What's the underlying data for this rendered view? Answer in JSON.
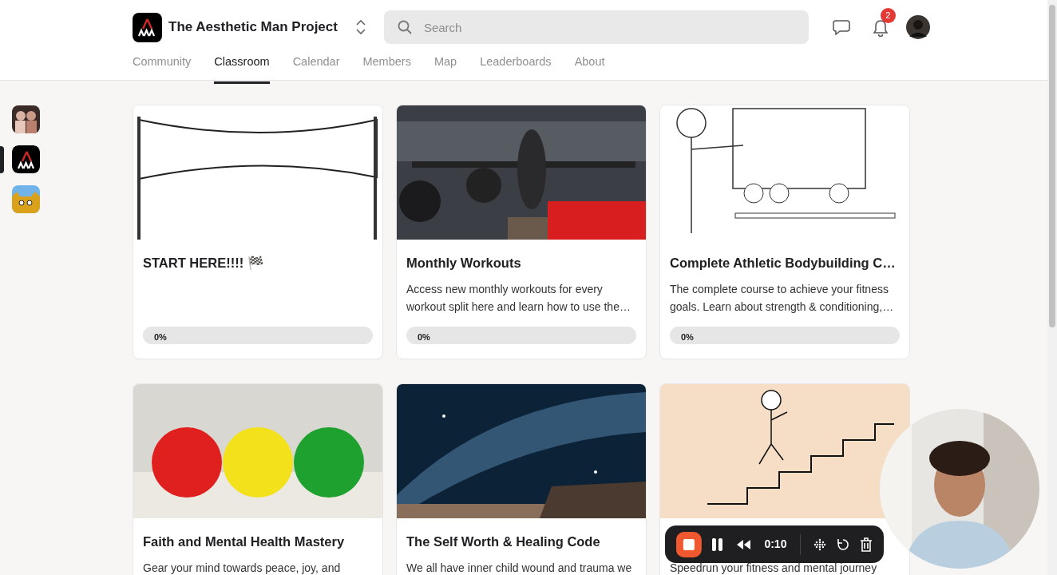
{
  "header": {
    "group_name": "The Aesthetic Man Project",
    "search": {
      "placeholder": "Search"
    },
    "notification_count": "2"
  },
  "tabs": [
    {
      "label": "Community",
      "selected": false
    },
    {
      "label": "Classroom",
      "selected": true
    },
    {
      "label": "Calendar",
      "selected": false
    },
    {
      "label": "Members",
      "selected": false
    },
    {
      "label": "Map",
      "selected": false
    },
    {
      "label": "Leaderboards",
      "selected": false
    },
    {
      "label": "About",
      "selected": false
    }
  ],
  "sidebar": {
    "groups": [
      {
        "selected": false
      },
      {
        "selected": true
      },
      {
        "selected": false
      }
    ]
  },
  "courses": [
    {
      "title": "START HERE!!!! 🏁",
      "progress": "0%",
      "level": 0
    },
    {
      "title": "Monthly Workouts",
      "description": "Access new monthly workouts for every workout split here and learn how to use the…",
      "progress": "0%",
      "level": 0
    },
    {
      "title": "Complete Athletic Bodybuilding C…",
      "description": "The complete course to achieve your fitness goals. Learn about strength & conditioning,…",
      "progress": "0%",
      "level": 0
    },
    {
      "title": "Faith and Mental Health Mastery",
      "description": "Gear your mind towards peace, joy, and"
    },
    {
      "title": "The Self Worth & Healing Code",
      "description": "We all have inner child wound and trauma we"
    },
    {
      "description": "Speedrun your fitness and mental journey"
    }
  ],
  "recorder": {
    "time": "0:10"
  }
}
